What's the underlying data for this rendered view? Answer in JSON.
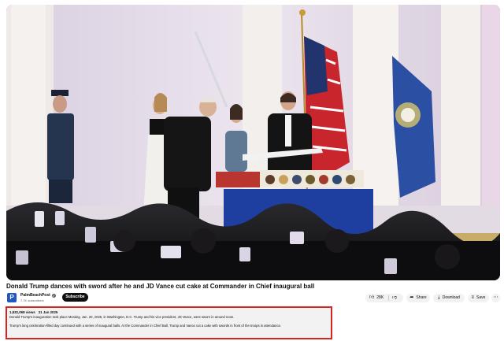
{
  "video": {
    "title": "Donald Trump dances with sword after he and JD Vance cut cake at Commander in Chief inaugural ball"
  },
  "channel": {
    "avatar_letter": "P",
    "name": "PalmBeachPost",
    "verified_icon": "check-icon",
    "subscribers": "7.7K subscribers",
    "subscribe_label": "Subscribe"
  },
  "actions": {
    "like_count": "28K",
    "like_icon": "thumbs-up-icon",
    "dislike_icon": "thumbs-down-icon",
    "share_label": "Share",
    "download_label": "Download",
    "save_label": "Save",
    "more_icon": "more-horizontal-icon"
  },
  "description": {
    "views": "1,832,098 views",
    "date": "21 Jan 2025",
    "line1": "Donald Trump's inauguration took place Monday, Jan. 20, 2025, in Washington, D.C. Trump and his vice president, JD Vance, were sworn in around noon.",
    "line2": "Trump's long celebration-filled day continued with a series of inaugural balls. At the Commander in Chief Ball, Trump and Vance cut a cake with swords in front of the troops in attendance.",
    "highlight_color": "#d8231f"
  },
  "colors": {
    "brand": "#1f57c3",
    "stage_backdrop": "#e7e0ea",
    "cake_table": "#1e3ea0"
  }
}
